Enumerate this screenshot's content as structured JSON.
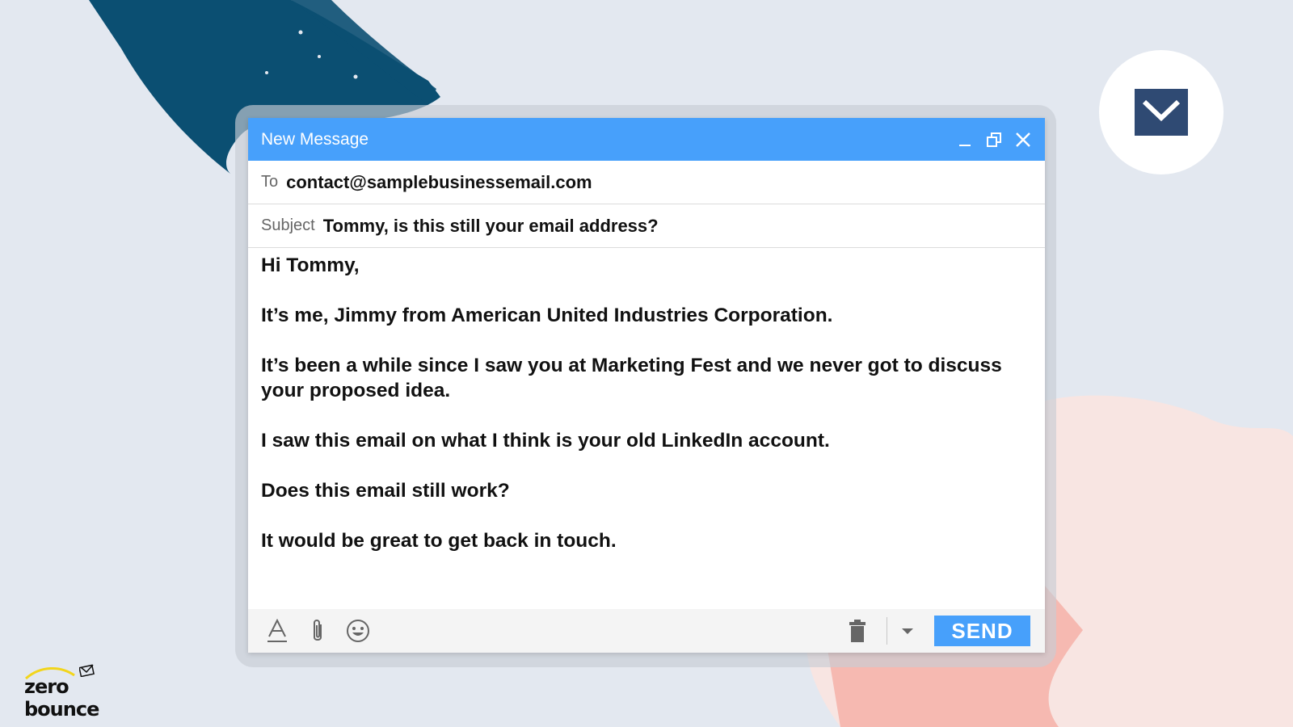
{
  "colors": {
    "accent": "#47a0fb",
    "background": "#e3e8f0",
    "brush_blue": "#0b4f72",
    "brush_pink": "#f6b9b1",
    "mail_icon": "#2f4a73"
  },
  "window": {
    "title": "New Message",
    "controls": [
      "minimize-icon",
      "restore-icon",
      "close-icon"
    ]
  },
  "fields": {
    "to_label": "To",
    "to_value": "contact@samplebusinessemail.com",
    "subject_label": "Subject",
    "subject_value": "Tommy, is this still your email address?"
  },
  "body": {
    "greeting": "Hi Tommy,",
    "para1": "It’s me, Jimmy from American United Industries Corporation.",
    "para2": "It’s been a while since I saw you at Marketing Fest  and we never got to discuss your proposed idea.",
    "para3": "I saw this email on what I think is your old LinkedIn account.",
    "para4": "Does this email still work?",
    "para5": "It would be great to get back in touch."
  },
  "toolbar": {
    "icons": [
      "text-format-icon",
      "attachment-icon",
      "emoji-icon",
      "trash-icon",
      "chevron-down-icon"
    ],
    "send_label": "SEND"
  },
  "logo": {
    "text": "zero bounce"
  }
}
